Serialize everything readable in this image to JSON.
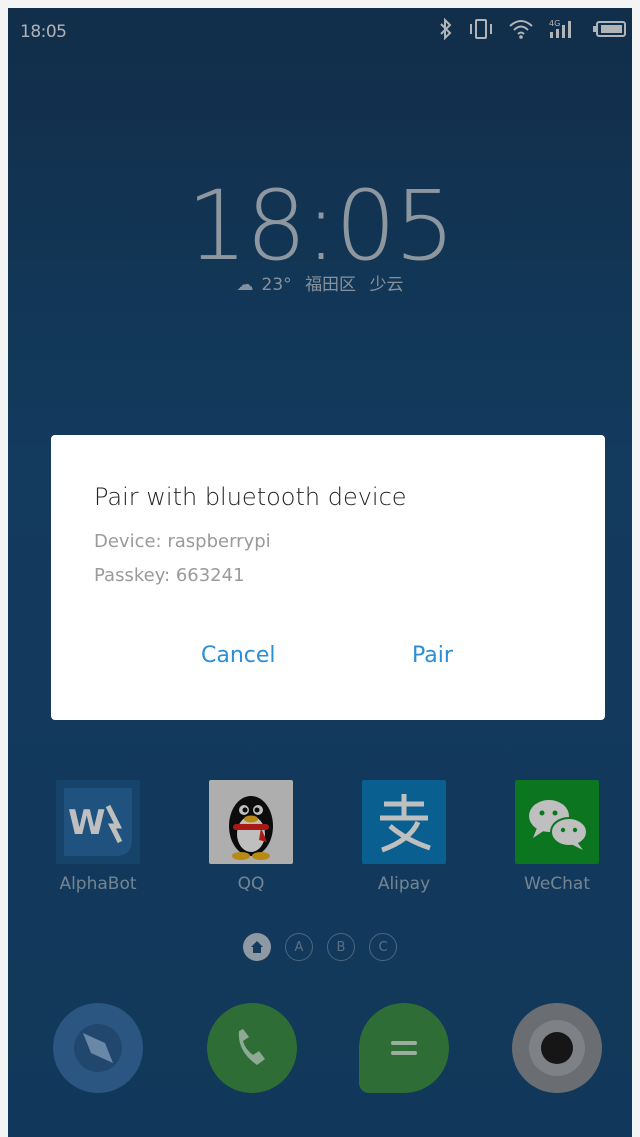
{
  "status_bar": {
    "time": "18:05",
    "icons": [
      "bluetooth-icon",
      "vibrate-icon",
      "wifi-icon",
      "signal-4g-icon",
      "battery-icon"
    ],
    "network_label": "4G"
  },
  "lockscreen": {
    "clock": "18:05",
    "weather": {
      "icon": "cloud-icon",
      "temp": "23°",
      "location": "福田区",
      "condition": "少云"
    }
  },
  "apps": [
    {
      "label": "AlphaBot",
      "icon": "alphabot-icon",
      "color": "#1a4f7d"
    },
    {
      "label": "QQ",
      "icon": "qq-penguin-icon",
      "color": "#ffffff"
    },
    {
      "label": "Alipay",
      "icon": "alipay-icon",
      "color": "#0b86c9"
    },
    {
      "label": "WeChat",
      "icon": "wechat-icon",
      "color": "#12b312"
    }
  ],
  "page_indicator": {
    "pages": [
      "home",
      "A",
      "B",
      "C"
    ],
    "active": "home"
  },
  "dock": [
    {
      "icon": "browser-compass-icon",
      "color": "#3b78b8"
    },
    {
      "icon": "phone-icon",
      "color": "#3f9a4a"
    },
    {
      "icon": "messages-icon",
      "color": "#3f9a4a"
    },
    {
      "icon": "camera-icon",
      "color": "#8a8f95"
    }
  ],
  "dialog": {
    "title": "Pair with bluetooth device",
    "device_line": "Device: raspberrypi",
    "passkey_line": "Passkey: 663241",
    "cancel_label": "Cancel",
    "pair_label": "Pair",
    "accent_color": "#2a8fd6"
  }
}
